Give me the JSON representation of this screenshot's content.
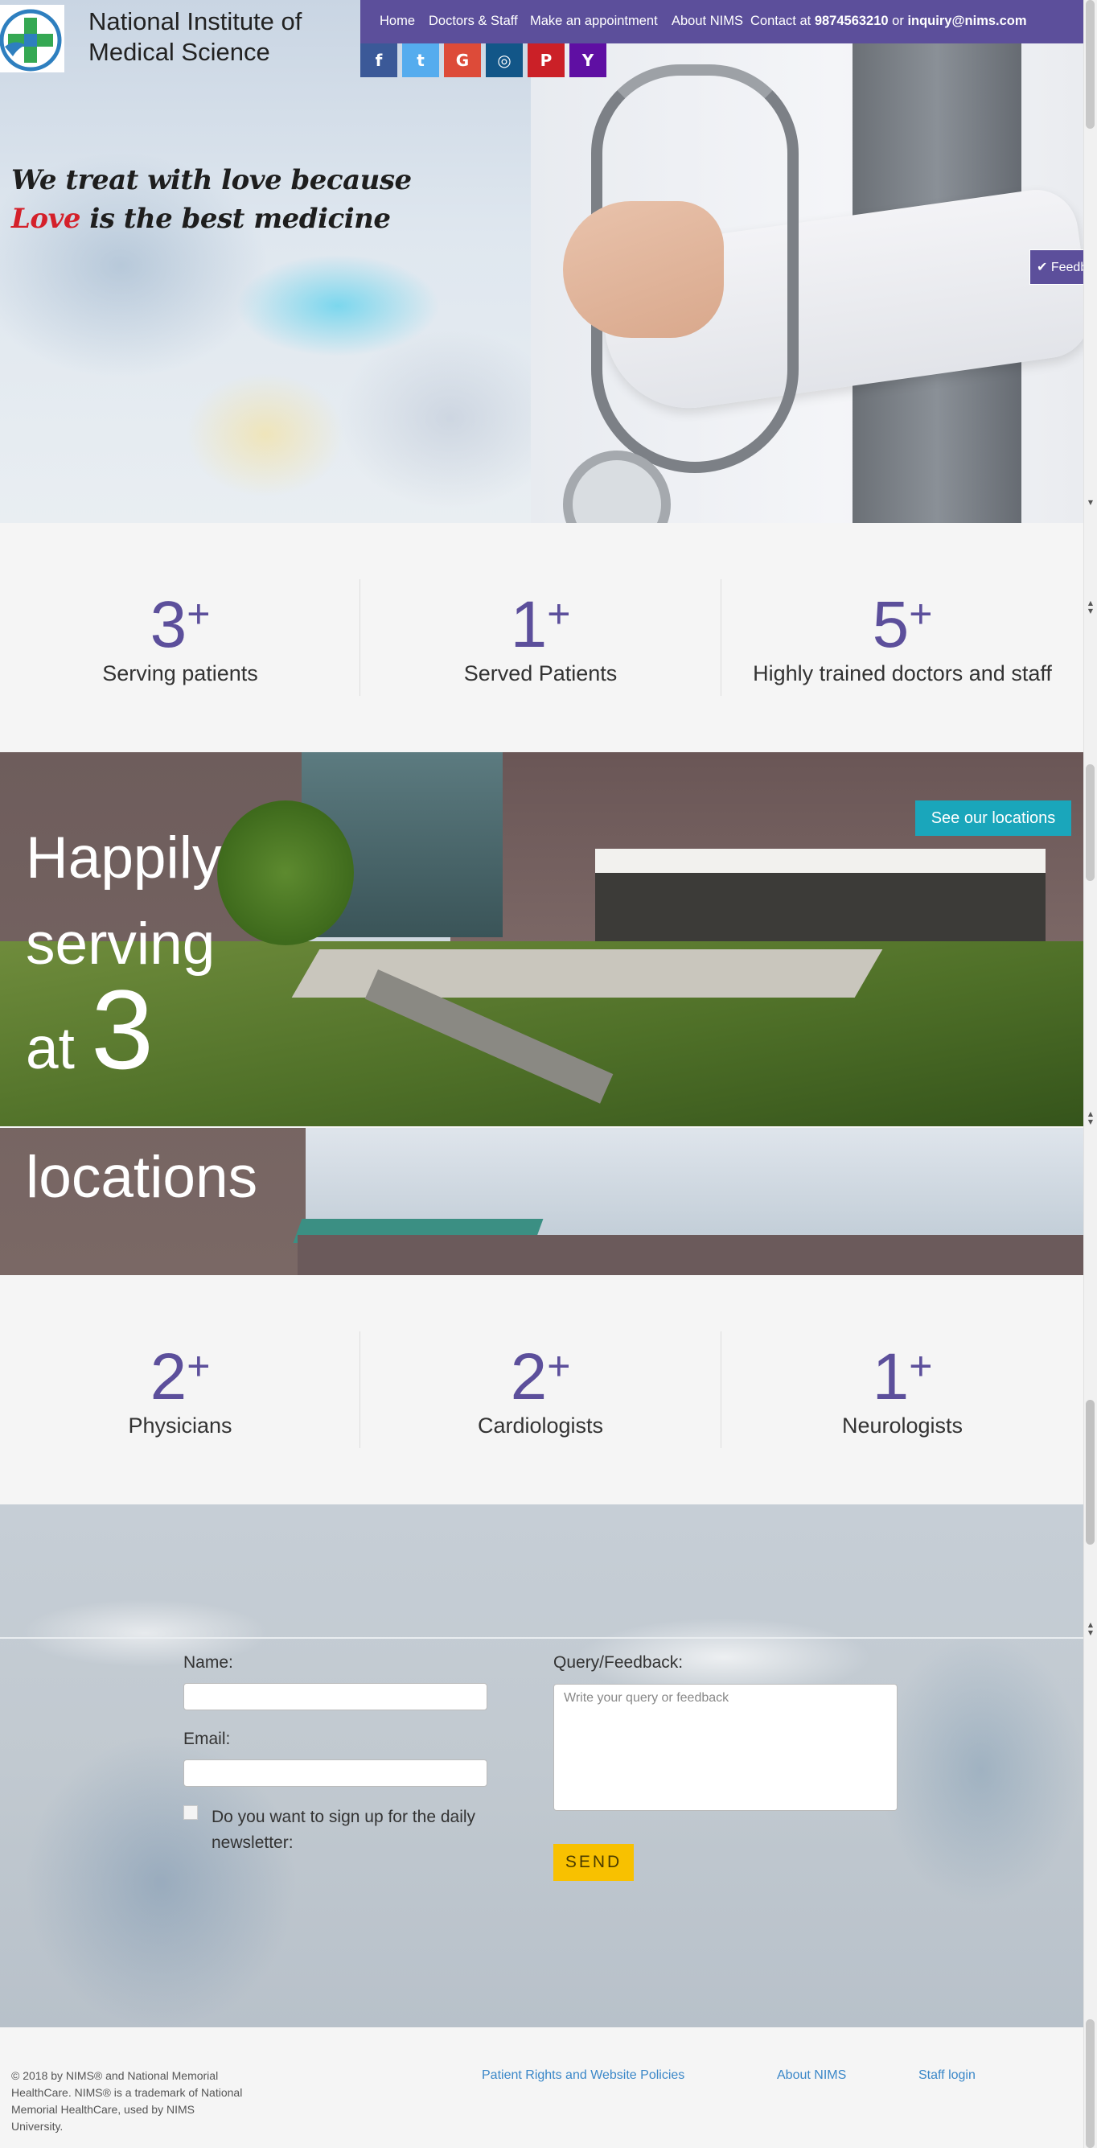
{
  "header": {
    "site_title_line1": "National Institute of",
    "site_title_line2": "Medical Science",
    "nav": {
      "home": "Home",
      "doctors": "Doctors & Staff",
      "appointment": "Make an appointment",
      "about": "About NIMS",
      "contact_prefix": "Contact at",
      "phone": "9874563210",
      "or": "or",
      "email": "inquiry@nims.com"
    },
    "social": {
      "facebook": "f",
      "twitter": "t",
      "google": "G",
      "instagram": "◎",
      "pinterest": "P",
      "ycombinator": "Y"
    },
    "social_colors": [
      "#3b5998",
      "#55acee",
      "#dd4b39",
      "#125688",
      "#cb2027",
      "#5f0fa3"
    ],
    "feedback_tab": "✔ Feedback"
  },
  "hero": {
    "tagline_line1": "We treat with love because",
    "tagline_love": "Love",
    "tagline_line2_rest": " is the best medicine"
  },
  "stats_top": [
    {
      "value": "3",
      "suffix": "+",
      "label": "Serving patients"
    },
    {
      "value": "1",
      "suffix": "+",
      "label": "Served Patients"
    },
    {
      "value": "5",
      "suffix": "+",
      "label": "Highly trained doctors and staff"
    }
  ],
  "locations": {
    "line1": "Happily",
    "line2": "serving",
    "at": "at",
    "count": "3",
    "line4": "locations",
    "button": "See our locations"
  },
  "stats_bottom": [
    {
      "value": "2",
      "suffix": "+",
      "label": "Physicians"
    },
    {
      "value": "2",
      "suffix": "+",
      "label": "Cardiologists"
    },
    {
      "value": "1",
      "suffix": "+",
      "label": "Neurologists"
    }
  ],
  "form": {
    "name_label": "Name:",
    "name_value": "",
    "email_label": "Email:",
    "email_value": "",
    "newsletter_label_line1": "Do you want to sign up for the daily",
    "newsletter_label_line2": "newsletter:",
    "query_label": "Query/Feedback:",
    "query_placeholder": "Write your query or feedback",
    "send": "SEND"
  },
  "footer": {
    "copyright_line1": "© 2018 by NIMS® and National Memorial",
    "copyright_line2": "HealthCare. NIMS® is a trademark of National",
    "copyright_line3": "Memorial HealthCare, used by NIMS",
    "copyright_line4": "University.",
    "links": [
      "Patient Rights and Website Policies",
      "About NIMS",
      "Staff login"
    ]
  },
  "colors": {
    "brand_purple": "#5c4f9b",
    "accent_teal": "#1aa6bb",
    "send_yellow": "#f8c100",
    "love_red": "#d4202a",
    "link_blue": "#3a87c8"
  }
}
